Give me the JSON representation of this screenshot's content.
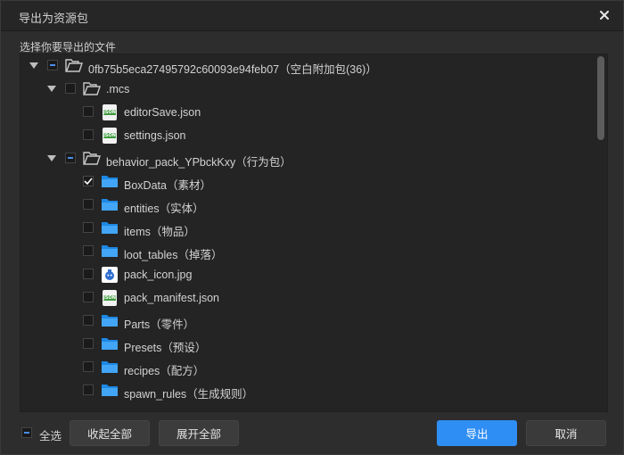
{
  "dialog": {
    "title": "导出为资源包",
    "section_label": "选择你要导出的文件"
  },
  "tree": [
    {
      "depth": 0,
      "type": "folder",
      "expanded": true,
      "state": "partial",
      "label": "0fb75b5eca27495792c60093e94feb07（空白附加包(36)）",
      "icon": "folder-open-icon"
    },
    {
      "depth": 1,
      "type": "folder",
      "expanded": true,
      "state": "unchecked",
      "label": ".mcs",
      "icon": "folder-open-icon"
    },
    {
      "depth": 2,
      "type": "file",
      "state": "unchecked",
      "label": "editorSave.json",
      "icon": "json-file-icon"
    },
    {
      "depth": 2,
      "type": "file",
      "state": "unchecked",
      "label": "settings.json",
      "icon": "json-file-icon"
    },
    {
      "depth": 1,
      "type": "folder",
      "expanded": true,
      "state": "partial",
      "label": "behavior_pack_YPbckKxy（行为包）",
      "icon": "folder-open-icon"
    },
    {
      "depth": 2,
      "type": "folder",
      "state": "checked",
      "label": "BoxData（素材）",
      "icon": "folder-blue-icon"
    },
    {
      "depth": 2,
      "type": "folder",
      "state": "unchecked",
      "label": "entities（实体）",
      "icon": "folder-blue-icon"
    },
    {
      "depth": 2,
      "type": "folder",
      "state": "unchecked",
      "label": "items（物品）",
      "icon": "folder-blue-icon"
    },
    {
      "depth": 2,
      "type": "folder",
      "state": "unchecked",
      "label": "loot_tables（掉落）",
      "icon": "folder-blue-icon"
    },
    {
      "depth": 2,
      "type": "file",
      "state": "unchecked",
      "label": "pack_icon.jpg",
      "icon": "pack-image-icon"
    },
    {
      "depth": 2,
      "type": "file",
      "state": "unchecked",
      "label": "pack_manifest.json",
      "icon": "json-file-icon"
    },
    {
      "depth": 2,
      "type": "folder",
      "state": "unchecked",
      "label": "Parts（零件）",
      "icon": "folder-blue-icon"
    },
    {
      "depth": 2,
      "type": "folder",
      "state": "unchecked",
      "label": "Presets（预设）",
      "icon": "folder-blue-icon"
    },
    {
      "depth": 2,
      "type": "folder",
      "state": "unchecked",
      "label": "recipes（配方）",
      "icon": "folder-blue-icon"
    },
    {
      "depth": 2,
      "type": "folder",
      "state": "unchecked",
      "label": "spawn_rules（生成规则）",
      "icon": "folder-blue-icon"
    }
  ],
  "footer": {
    "select_all_label": "全选",
    "select_all_state": "partial",
    "collapse_all_label": "收起全部",
    "expand_all_label": "展开全部",
    "export_label": "导出",
    "cancel_label": "取消"
  },
  "colors": {
    "accent": "#2f8ef4",
    "background": "#2d2d2d",
    "tree_background": "#242424"
  }
}
